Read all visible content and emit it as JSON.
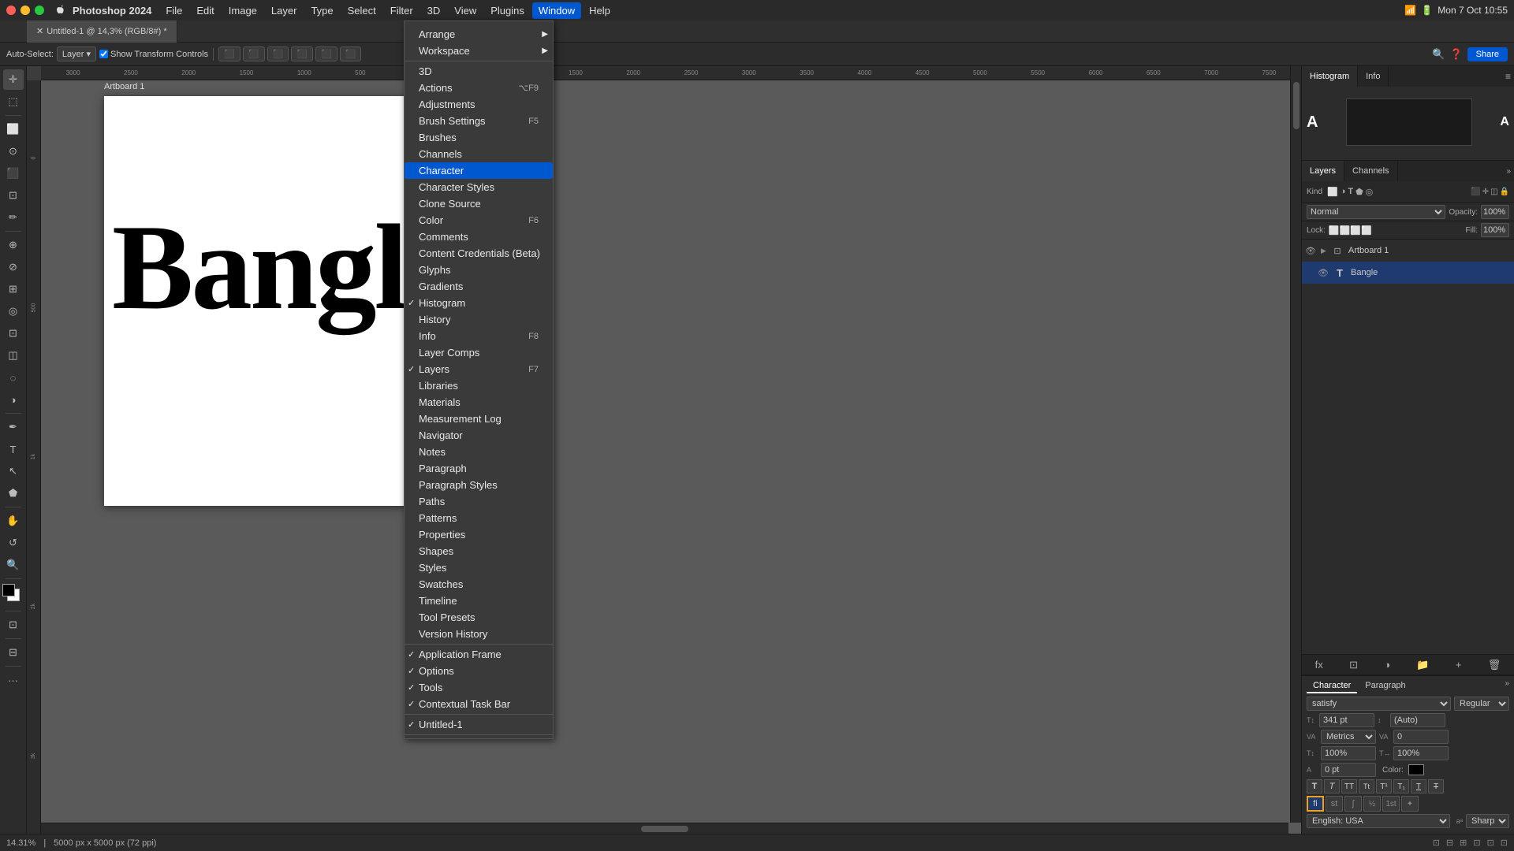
{
  "app": {
    "name": "Photoshop 2024",
    "time": "Mon 7 Oct  10:55"
  },
  "menubar": {
    "items": [
      "File",
      "Edit",
      "Image",
      "Layer",
      "Type",
      "Select",
      "Filter",
      "3D",
      "View",
      "Plugins",
      "Window",
      "Help"
    ]
  },
  "tab": {
    "title": "Untitled-1 @ 14,3% (RGB/8#) *",
    "zoom": "14.31%",
    "dimensions": "5000 px x 5000 px (72 ppi)"
  },
  "optionsbar": {
    "mode": "Auto-Select:",
    "layer_label": "Layer",
    "transform_label": "Show Transform Controls"
  },
  "artboard": {
    "label": "Artboard 1"
  },
  "canvas_text": "Bangle",
  "window_menu": {
    "items_group1": [
      {
        "label": "Arrange",
        "has_arrow": true,
        "checked": false
      },
      {
        "label": "Workspace",
        "has_arrow": true,
        "checked": false
      }
    ],
    "items_group2": [
      {
        "label": "3D",
        "checked": false,
        "shortcut": ""
      },
      {
        "label": "Actions",
        "checked": false,
        "shortcut": "⌥F9"
      },
      {
        "label": "Adjustments",
        "checked": false,
        "shortcut": ""
      },
      {
        "label": "Brush Settings",
        "checked": false,
        "shortcut": "F5"
      },
      {
        "label": "Brushes",
        "checked": false,
        "shortcut": ""
      },
      {
        "label": "Channels",
        "checked": false,
        "shortcut": ""
      },
      {
        "label": "Character",
        "checked": false,
        "shortcut": "",
        "highlighted": true
      },
      {
        "label": "Character Styles",
        "checked": false,
        "shortcut": ""
      },
      {
        "label": "Clone Source",
        "checked": false,
        "shortcut": ""
      },
      {
        "label": "Color",
        "checked": false,
        "shortcut": "F6"
      },
      {
        "label": "Comments",
        "checked": false,
        "shortcut": ""
      },
      {
        "label": "Content Credentials (Beta)",
        "checked": false,
        "shortcut": ""
      },
      {
        "label": "Glyphs",
        "checked": false,
        "shortcut": ""
      },
      {
        "label": "Gradients",
        "checked": false,
        "shortcut": ""
      },
      {
        "label": "Histogram",
        "checked": true,
        "shortcut": ""
      },
      {
        "label": "History",
        "checked": false,
        "shortcut": ""
      },
      {
        "label": "Info",
        "checked": false,
        "shortcut": "F8"
      },
      {
        "label": "Layer Comps",
        "checked": false,
        "shortcut": ""
      },
      {
        "label": "Layers",
        "checked": true,
        "shortcut": "F7"
      },
      {
        "label": "Libraries",
        "checked": false,
        "shortcut": ""
      },
      {
        "label": "Materials",
        "checked": false,
        "shortcut": ""
      },
      {
        "label": "Measurement Log",
        "checked": false,
        "shortcut": ""
      },
      {
        "label": "Navigator",
        "checked": false,
        "shortcut": ""
      },
      {
        "label": "Notes",
        "checked": false,
        "shortcut": ""
      },
      {
        "label": "Paragraph",
        "checked": false,
        "shortcut": ""
      },
      {
        "label": "Paragraph Styles",
        "checked": false,
        "shortcut": ""
      },
      {
        "label": "Paths",
        "checked": false,
        "shortcut": ""
      },
      {
        "label": "Patterns",
        "checked": false,
        "shortcut": ""
      },
      {
        "label": "Properties",
        "checked": false,
        "shortcut": ""
      },
      {
        "label": "Shapes",
        "checked": false,
        "shortcut": ""
      },
      {
        "label": "Styles",
        "checked": false,
        "shortcut": ""
      },
      {
        "label": "Swatches",
        "checked": false,
        "shortcut": ""
      },
      {
        "label": "Timeline",
        "checked": false,
        "shortcut": ""
      },
      {
        "label": "Tool Presets",
        "checked": false,
        "shortcut": ""
      },
      {
        "label": "Version History",
        "checked": false,
        "shortcut": ""
      }
    ],
    "items_group3": [
      {
        "label": "Application Frame",
        "checked": true,
        "shortcut": ""
      },
      {
        "label": "Options",
        "checked": true,
        "shortcut": ""
      },
      {
        "label": "Tools",
        "checked": true,
        "shortcut": ""
      },
      {
        "label": "Contextual Task Bar",
        "checked": true,
        "shortcut": ""
      }
    ],
    "items_group4": [
      {
        "label": "Untitled-1",
        "checked": true,
        "shortcut": ""
      }
    ]
  },
  "right_panel": {
    "top_tabs": [
      "Histogram",
      "Info"
    ],
    "layers_tabs": [
      "Layers",
      "Channels"
    ],
    "layer_items": [
      {
        "name": "Artboard 1",
        "type": "artboard",
        "visible": true
      },
      {
        "name": "Bangle",
        "type": "text",
        "visible": true
      }
    ]
  },
  "character_panel": {
    "tabs": [
      "Character",
      "Paragraph"
    ],
    "font_family": "satisfy",
    "font_style": "Regular",
    "font_size": "341 pt",
    "leading": "(Auto)",
    "kerning": "Metrics",
    "tracking": "0",
    "scale_v": "100%",
    "scale_h": "100%",
    "baseline": "0 pt",
    "language": "English: USA",
    "aa": "Sharp"
  },
  "status": {
    "zoom": "14.31%",
    "dimensions": "5000 px x 5000 px (72 ppi)"
  },
  "toolbar_tools": [
    "move",
    "marquee",
    "lasso",
    "crop",
    "eyedropper",
    "healing",
    "brush",
    "stamp",
    "eraser",
    "gradient",
    "blur",
    "dodge",
    "pen",
    "text",
    "path-select",
    "shapes",
    "hand",
    "zoom"
  ]
}
